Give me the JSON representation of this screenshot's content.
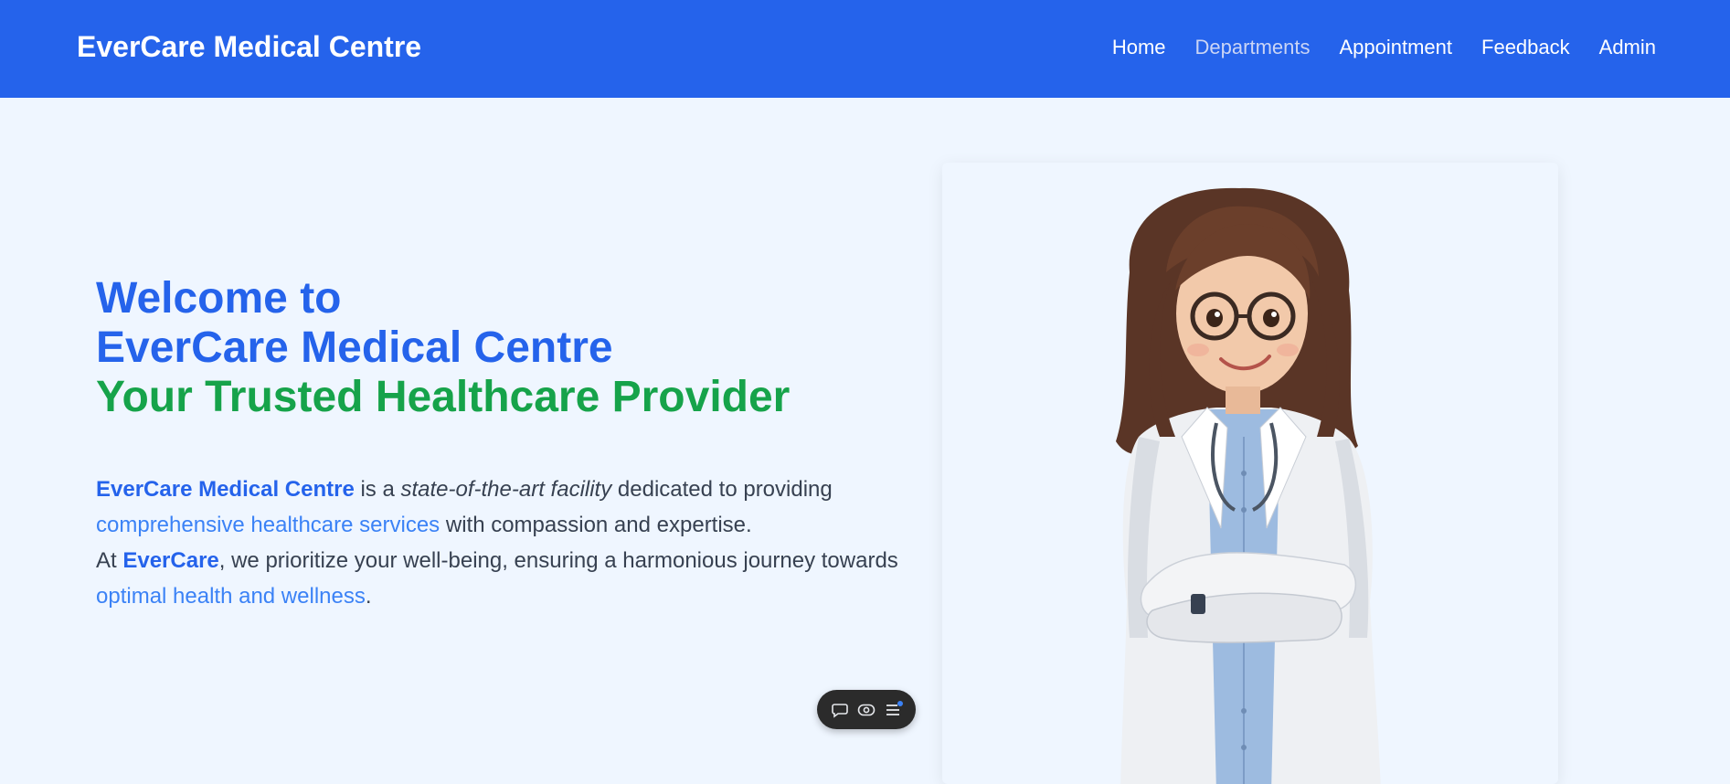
{
  "colors": {
    "primary": "#2563eb",
    "accent_green": "#16a34a",
    "link_blue": "#3b82f6",
    "page_bg": "#eff6ff",
    "text": "#374151"
  },
  "nav": {
    "brand": "EverCare Medical Centre",
    "items": [
      {
        "label": "Home",
        "active": false
      },
      {
        "label": "Departments",
        "active": true
      },
      {
        "label": "Appointment",
        "active": false
      },
      {
        "label": "Feedback",
        "active": false
      },
      {
        "label": "Admin",
        "active": false
      }
    ]
  },
  "hero": {
    "title_line1": "Welcome to",
    "title_line2": "EverCare Medical Centre",
    "title_line3": "Your Trusted Healthcare Provider",
    "desc": {
      "brand_name": "EverCare Medical Centre",
      "t1": " is a ",
      "facility": "state-of-the-art facility",
      "t2": " dedicated to providing ",
      "services": "comprehensive healthcare services",
      "t3": " with compassion and expertise.",
      "t4": "At ",
      "brand_short": "EverCare",
      "t5": ", we prioritize your well-being, ensuring a harmonious journey towards ",
      "wellness": "optimal health and wellness",
      "t6": "."
    }
  },
  "toolbar": {
    "icons": [
      "chat-bubble-icon",
      "eye-toggle-icon",
      "menu-list-icon"
    ]
  }
}
